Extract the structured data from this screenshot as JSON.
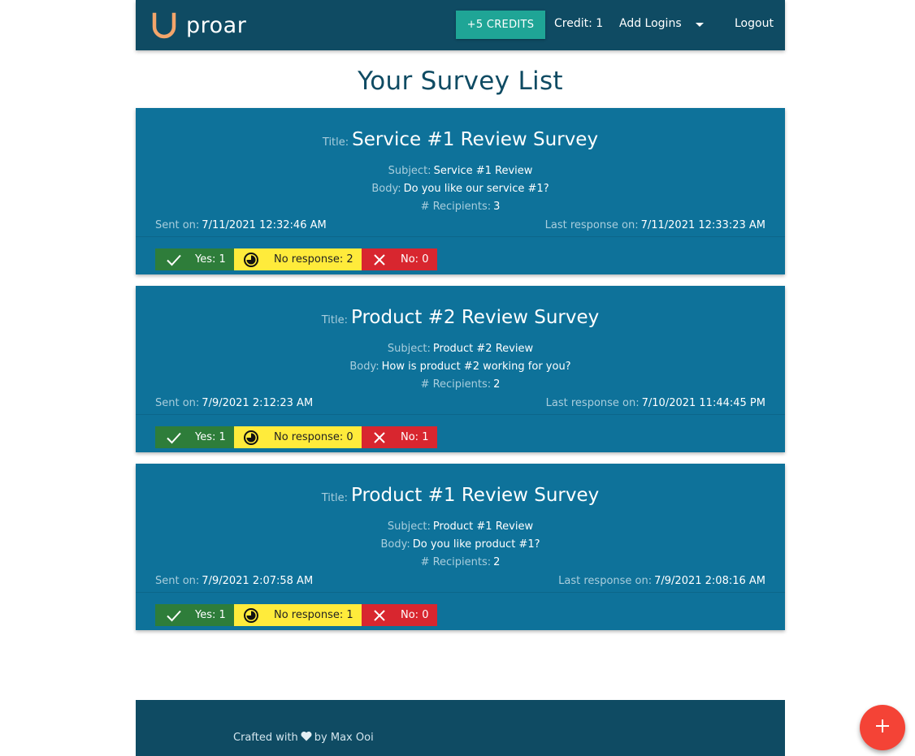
{
  "navbar": {
    "logo_icon": "horseshoe-u-icon",
    "brand": "proar",
    "credits_button": "+5 CREDITS",
    "credit_label": "Credit:",
    "credit_value": "1",
    "add_logins": "Add Logins",
    "logout": "Logout"
  },
  "page_title": "Your Survey List",
  "labels": {
    "title": "Title:",
    "subject": "Subject:",
    "body": "Body:",
    "recipients": "# Recipients:",
    "sent_on": "Sent on:",
    "last_response": "Last response on:",
    "yes": "Yes:",
    "no_response": "No response:",
    "no": "No:"
  },
  "surveys": [
    {
      "title": "Service #1 Review Survey",
      "subject": "Service #1 Review",
      "body": "Do you like our service #1?",
      "recipients": "3",
      "sent_on": "7/11/2021 12:32:46 AM",
      "last_response": "7/11/2021 12:33:23 AM",
      "yes": "1",
      "no_response": "2",
      "no": "0"
    },
    {
      "title": "Product #2 Review Survey",
      "subject": "Product #2 Review",
      "body": "How is product #2 working for you?",
      "recipients": "2",
      "sent_on": "7/9/2021 2:12:23 AM",
      "last_response": "7/10/2021 11:44:45 PM",
      "yes": "1",
      "no_response": "0",
      "no": "1"
    },
    {
      "title": "Product #1 Review Survey",
      "subject": "Product #1 Review",
      "body": "Do you like product #1?",
      "recipients": "2",
      "sent_on": "7/9/2021 2:07:58 AM",
      "last_response": "7/9/2021 2:08:16 AM",
      "yes": "1",
      "no_response": "1",
      "no": "0"
    }
  ],
  "footer": {
    "crafted": "Crafted with",
    "by": "by Max Ooi"
  },
  "colors": {
    "navbar": "#0f4b63",
    "card": "#0e729a",
    "accent_button": "#1fa596",
    "yes": "#2e7d3a",
    "no_response": "#ffeb3b",
    "no": "#d8262f",
    "fab": "#f44336"
  }
}
